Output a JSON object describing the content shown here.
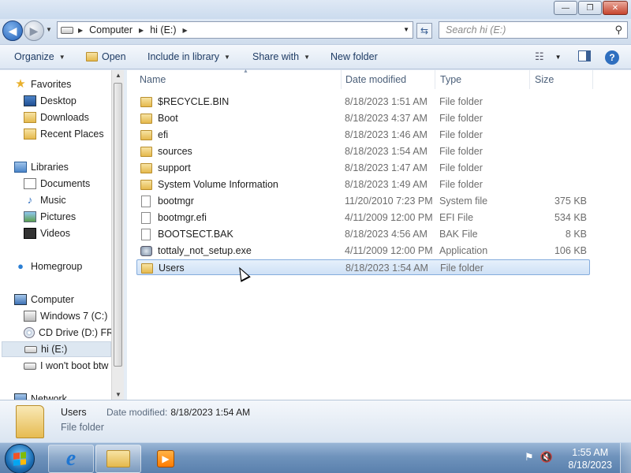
{
  "window": {
    "minimize_glyph": "—",
    "maximize_glyph": "❐",
    "close_glyph": "✕"
  },
  "address": {
    "segments": [
      "Computer",
      "hi (E:)"
    ],
    "search_placeholder": "Search hi (E:)"
  },
  "toolbar": {
    "organize": "Organize",
    "open": "Open",
    "include_in_library": "Include in library",
    "share_with": "Share with",
    "new_folder": "New folder"
  },
  "navpane": {
    "favorites": "Favorites",
    "desktop": "Desktop",
    "downloads": "Downloads",
    "recent_places": "Recent Places",
    "libraries": "Libraries",
    "documents": "Documents",
    "music": "Music",
    "pictures": "Pictures",
    "videos": "Videos",
    "homegroup": "Homegroup",
    "computer": "Computer",
    "windows7": "Windows 7 (C:)",
    "cd_drive": "CD Drive (D:) FRT",
    "hi_drive": "hi (E:)",
    "wont_boot": "I won't boot btw",
    "network": "Network"
  },
  "columns": {
    "name": "Name",
    "date_modified": "Date modified",
    "type": "Type",
    "size": "Size"
  },
  "files": [
    {
      "name": "$RECYCLE.BIN",
      "date": "8/18/2023 1:51 AM",
      "type": "File folder",
      "size": "",
      "icon": "folder-icon"
    },
    {
      "name": "Boot",
      "date": "8/18/2023 4:37 AM",
      "type": "File folder",
      "size": "",
      "icon": "folder-icon"
    },
    {
      "name": "efi",
      "date": "8/18/2023 1:46 AM",
      "type": "File folder",
      "size": "",
      "icon": "folder-icon"
    },
    {
      "name": "sources",
      "date": "8/18/2023 1:54 AM",
      "type": "File folder",
      "size": "",
      "icon": "folder-icon"
    },
    {
      "name": "support",
      "date": "8/18/2023 1:47 AM",
      "type": "File folder",
      "size": "",
      "icon": "folder-icon"
    },
    {
      "name": "System Volume Information",
      "date": "8/18/2023 1:49 AM",
      "type": "File folder",
      "size": "",
      "icon": "folder-icon"
    },
    {
      "name": "bootmgr",
      "date": "11/20/2010 7:23 PM",
      "type": "System file",
      "size": "375 KB",
      "icon": "file-icon"
    },
    {
      "name": "bootmgr.efi",
      "date": "4/11/2009 12:00 PM",
      "type": "EFI File",
      "size": "534 KB",
      "icon": "file-icon"
    },
    {
      "name": "BOOTSECT.BAK",
      "date": "8/18/2023 4:56 AM",
      "type": "BAK File",
      "size": "8 KB",
      "icon": "file-icon"
    },
    {
      "name": "tottaly_not_setup.exe",
      "date": "4/11/2009 12:00 PM",
      "type": "Application",
      "size": "106 KB",
      "icon": "exe-icon"
    },
    {
      "name": "Users",
      "date": "8/18/2023 1:54 AM",
      "type": "File folder",
      "size": "",
      "icon": "folder-icon",
      "selected": true
    }
  ],
  "details": {
    "name": "Users",
    "type": "File folder",
    "date_label": "Date modified:",
    "date_value": "8/18/2023 1:54 AM"
  },
  "taskbar": {
    "ie_glyph": "e",
    "time": "1:55 AM",
    "date": "8/18/2023"
  },
  "colors": {
    "selection": "#cfe1f6",
    "accent": "#1e3b64"
  }
}
